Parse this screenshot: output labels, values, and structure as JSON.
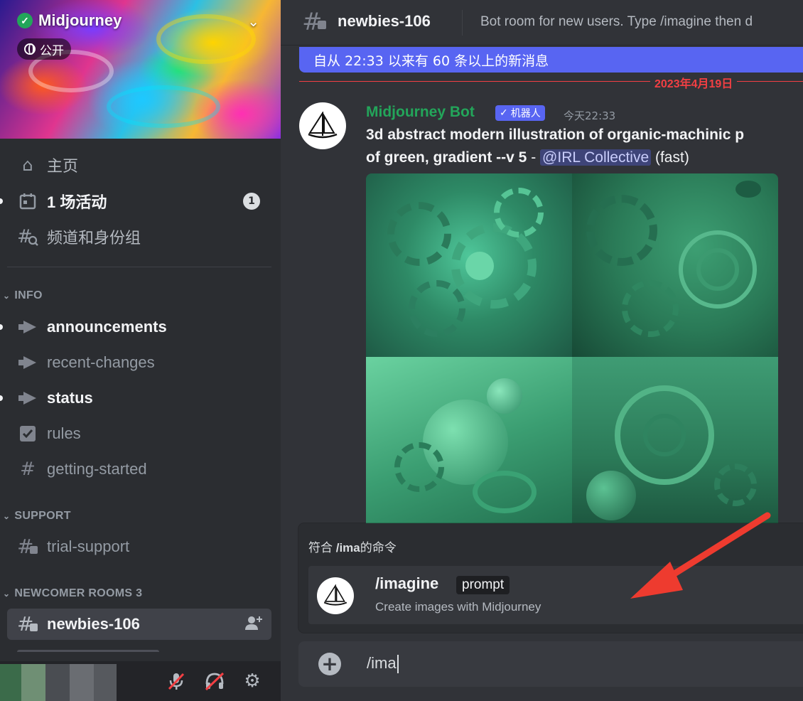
{
  "server": {
    "name": "Midjourney",
    "public_label": "公开"
  },
  "sidebar": {
    "top_items": [
      {
        "label": "主页",
        "icon": "home-icon"
      },
      {
        "label": "1 场活动",
        "icon": "calendar-icon",
        "badge": "1"
      },
      {
        "label": "频道和身份组",
        "icon": "channel-browse-icon"
      }
    ],
    "categories": [
      {
        "name": "INFO",
        "channels": [
          {
            "label": "announcements",
            "icon": "megaphone-icon",
            "unread": true
          },
          {
            "label": "recent-changes",
            "icon": "megaphone-icon",
            "unread": false
          },
          {
            "label": "status",
            "icon": "megaphone-icon",
            "unread": true
          },
          {
            "label": "rules",
            "icon": "checkbox-icon",
            "unread": false
          },
          {
            "label": "getting-started",
            "icon": "hash-icon",
            "unread": false
          }
        ]
      },
      {
        "name": "SUPPORT",
        "channels": [
          {
            "label": "trial-support",
            "icon": "thread-hash-icon",
            "unread": false
          }
        ]
      },
      {
        "name": "NEWCOMER ROOMS 3",
        "channels": [
          {
            "label": "newbies-106",
            "icon": "thread-hash-icon",
            "active": true
          }
        ]
      }
    ]
  },
  "header": {
    "channel_name": "newbies-106",
    "topic": "Bot room for new users. Type /imagine then d"
  },
  "new_messages_bar": "自从 22:33 以来有 60 条以上的新消息",
  "date_divider": "2023年4月19日",
  "message": {
    "author": "Midjourney Bot",
    "bot_tag": "机器人",
    "timestamp": "今天22:33",
    "line1": "3d abstract modern illustration of organic-machinic p",
    "line2_bold": "of green, gradient --v 5",
    "line2_sep": " - ",
    "mention": "@IRL Collective",
    "speed": " (fast)"
  },
  "command_popup": {
    "header_prefix": "符合 ",
    "header_query": "/ima",
    "header_suffix": "的命令",
    "command_name": "/imagine",
    "command_param": "prompt",
    "command_desc": "Create images with Midjourney"
  },
  "input": {
    "value": "/ima"
  },
  "colors": {
    "accent": "#5865f2",
    "bot_name": "#23a55a",
    "new_divider": "#f23f43",
    "annotation_arrow": "#ee3b2f"
  }
}
